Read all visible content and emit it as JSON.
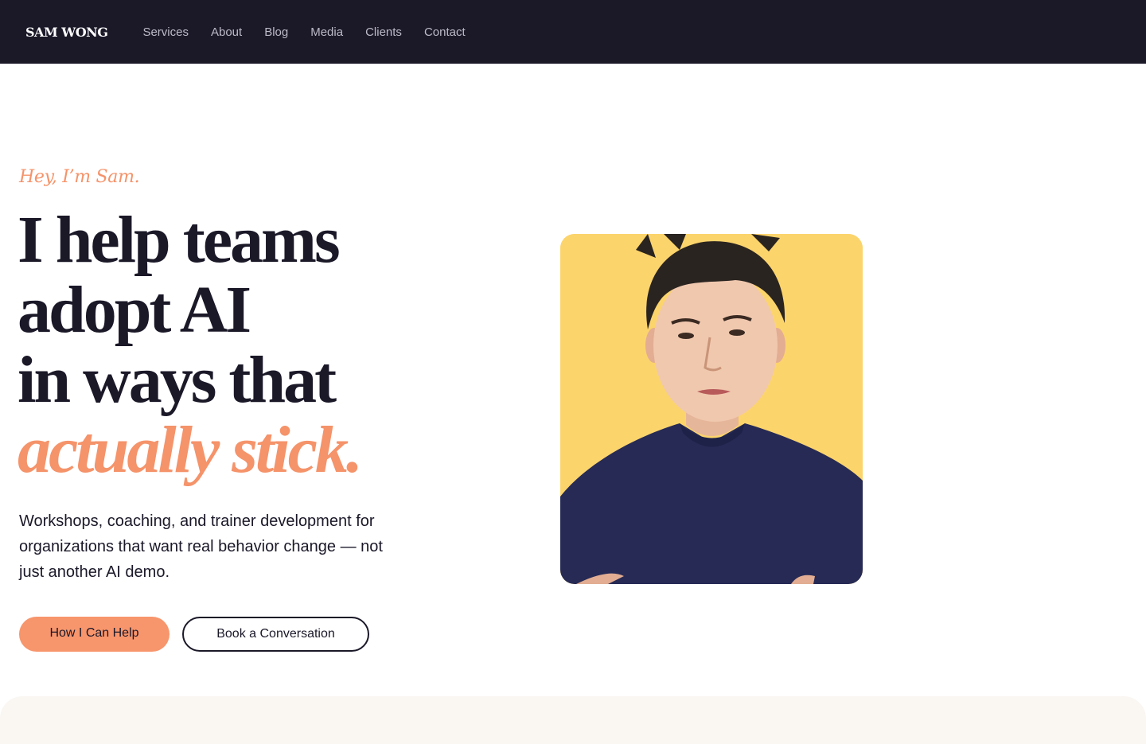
{
  "nav": {
    "brand": "SAM WONG",
    "links": [
      "Services",
      "About",
      "Blog",
      "Media",
      "Clients",
      "Contact"
    ]
  },
  "hero": {
    "eyebrow": "Hey, I’m Sam.",
    "headline_lines": [
      "I help teams",
      "adopt AI",
      "in ways that"
    ],
    "headline_accent": "actually stick.",
    "description": "Workshops, coaching, and trainer development for organizations that want real behavior change — not just another AI demo.",
    "primary_cta": "How I Can Help",
    "secondary_cta": "Book a Conversation",
    "portrait": "photo-portrait"
  },
  "colors": {
    "nav_bg": "#1b1828",
    "accent": "#f5936a",
    "text_dark": "#1b1828",
    "portrait_bg": "#fcd46c",
    "section_bg": "#faf6f2"
  }
}
